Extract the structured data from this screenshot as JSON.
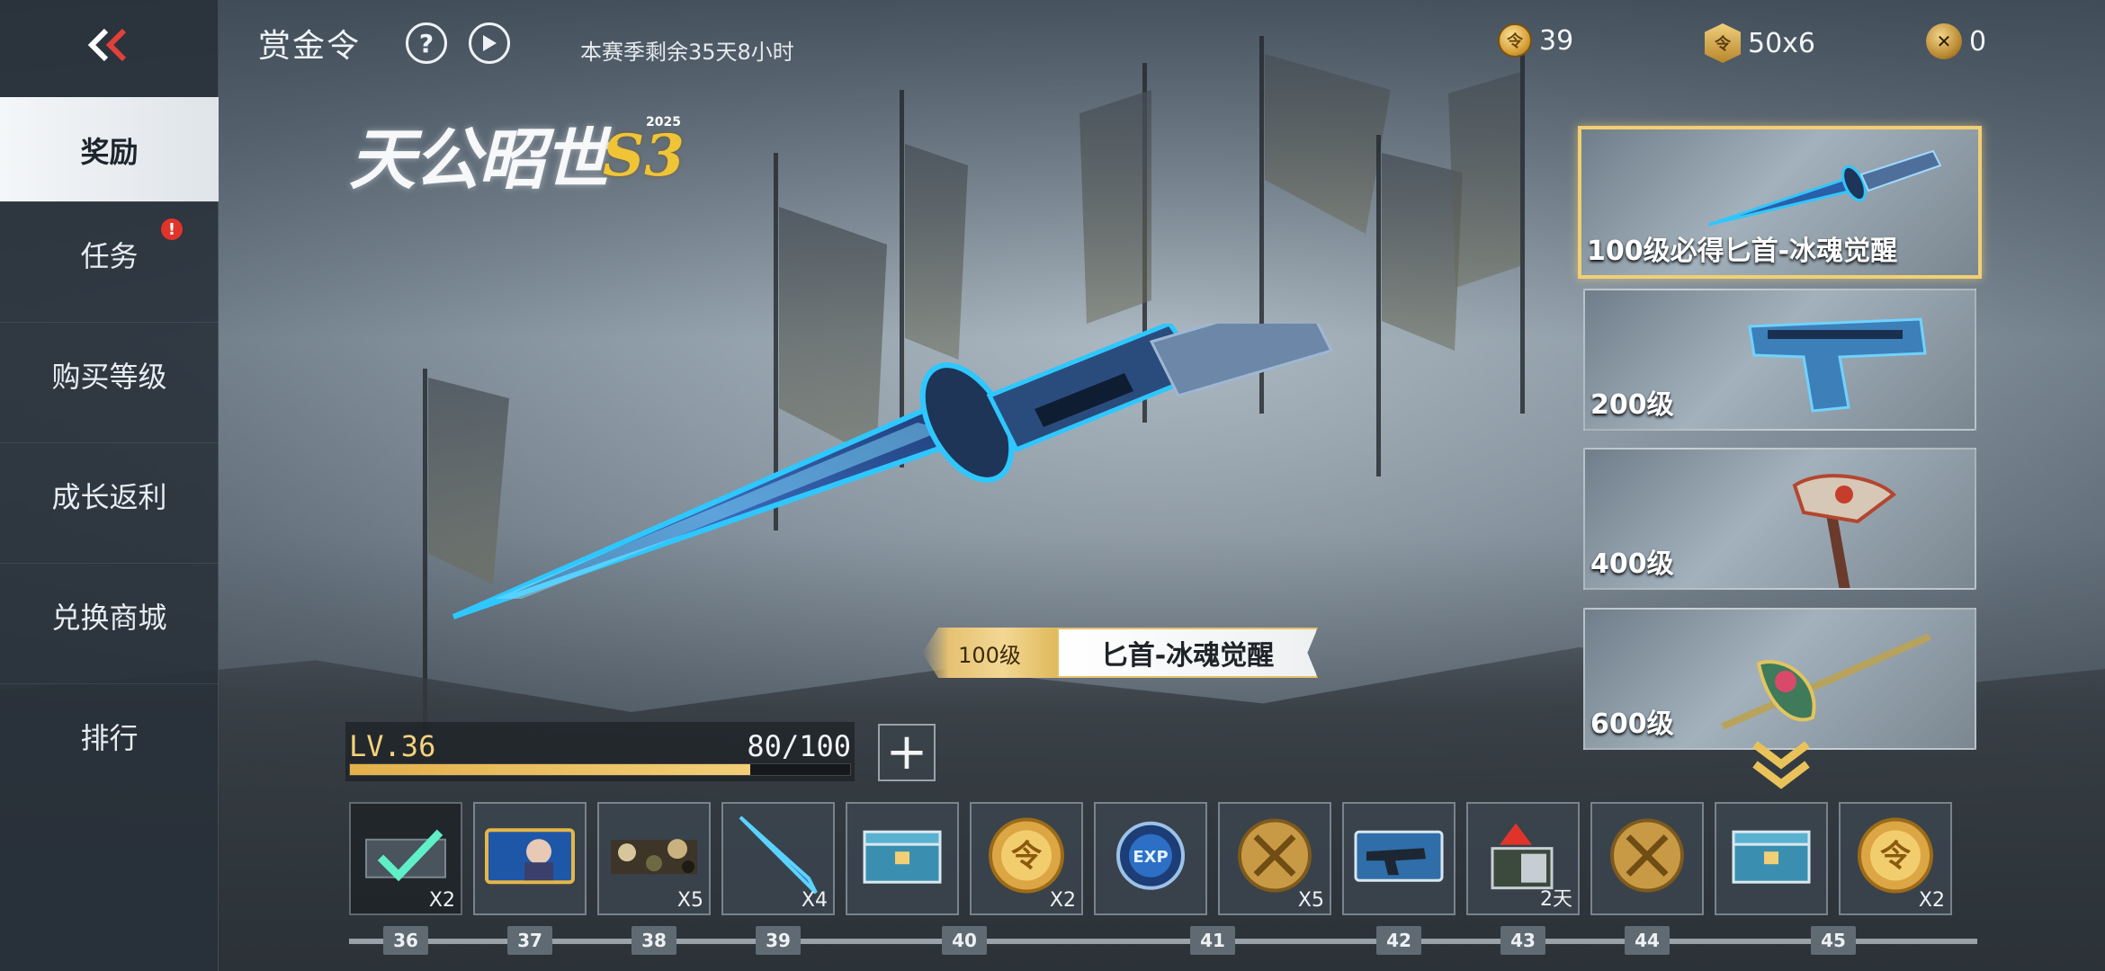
{
  "header": {
    "title": "赏金令",
    "help_icon": "question-icon",
    "play_icon": "play-icon",
    "season_remaining": "本赛季剩余35天8小时"
  },
  "currencies": [
    {
      "icon": "gold-coin-icon",
      "value": "39"
    },
    {
      "icon": "ticket-icon",
      "value": "50x6"
    },
    {
      "icon": "cross-coin-icon",
      "value": "0"
    }
  ],
  "sidebar": {
    "items": [
      {
        "label": "奖励",
        "active": true,
        "badge": false
      },
      {
        "label": "任务",
        "active": false,
        "badge": true,
        "badge_text": "!"
      },
      {
        "label": "购买等级",
        "active": false,
        "badge": false
      },
      {
        "label": "成长返利",
        "active": false,
        "badge": false
      },
      {
        "label": "兑换商城",
        "active": false,
        "badge": false
      },
      {
        "label": "排行",
        "active": false,
        "badge": false
      }
    ]
  },
  "logo": {
    "text": "天公昭世",
    "year": "2025",
    "season": "S3"
  },
  "featured": {
    "level_tag": "100级",
    "name": "匕首-冰魂觉醒"
  },
  "level": {
    "label": "LV.36",
    "progress_text": "80/100",
    "progress": 0.8,
    "plus_label": "+"
  },
  "reward_cards": [
    {
      "label": "100级必得匕首-冰魂觉醒",
      "selected": true,
      "icon": "dagger-icon"
    },
    {
      "label": "200级",
      "selected": false,
      "icon": "pistol-icon"
    },
    {
      "label": "400级",
      "selected": false,
      "icon": "axe-icon"
    },
    {
      "label": "600级",
      "selected": false,
      "icon": "halberd-icon"
    }
  ],
  "items": [
    {
      "icon": "card-claimed-icon",
      "qty": "X2",
      "claimed": true
    },
    {
      "icon": "avatar-card-icon",
      "qty": "",
      "claimed": false
    },
    {
      "icon": "camo-icon",
      "qty": "X5",
      "claimed": false
    },
    {
      "icon": "blade-icon",
      "qty": "X4",
      "claimed": false
    },
    {
      "icon": "crate-icon",
      "qty": "",
      "claimed": false
    },
    {
      "icon": "gold-coin-icon",
      "qty": "X2",
      "claimed": false
    },
    {
      "icon": "exp-token-icon",
      "qty": "",
      "claimed": false
    },
    {
      "icon": "cross-coin-icon",
      "qty": "X5",
      "claimed": false
    },
    {
      "icon": "weapon-card-icon",
      "qty": "",
      "claimed": false
    },
    {
      "icon": "box-arrow-icon",
      "qty": "2天",
      "claimed": false
    },
    {
      "icon": "cross-coin-icon",
      "qty": "",
      "claimed": false
    },
    {
      "icon": "crate-icon",
      "qty": "",
      "claimed": false
    },
    {
      "icon": "gold-coin-icon",
      "qty": "X2",
      "claimed": false
    }
  ],
  "level_markers": [
    "36",
    "37",
    "38",
    "39",
    "40",
    "41",
    "42",
    "43",
    "44",
    "45"
  ],
  "colors": {
    "accent_gold": "#f1cf74",
    "badge_red": "#e0342b",
    "ice_blue": "#2fc7ff"
  }
}
